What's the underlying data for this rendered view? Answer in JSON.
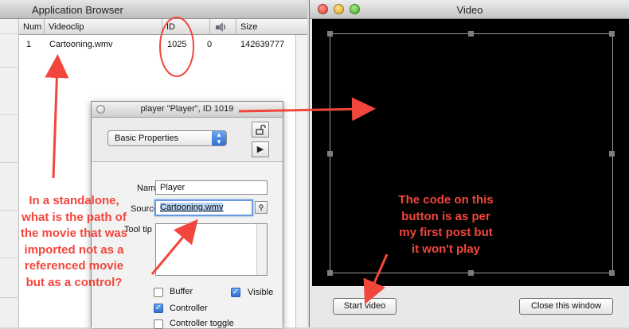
{
  "app_browser": {
    "title": "Application Browser",
    "columns": [
      "Num",
      "Videoclip",
      "ID",
      "",
      "Size"
    ],
    "header_icon": "speaker-icon",
    "rows": [
      {
        "num": "1",
        "videoclip": "Cartooning.wmv",
        "id": "1025",
        "flag": "0",
        "size": "142639777"
      }
    ]
  },
  "inspector": {
    "title": "player \"Player\", ID 1019",
    "dropdown_value": "Basic Properties",
    "lock_icon": "unlock-icon",
    "play_icon": "play-icon",
    "name_label": "Name",
    "name_value": "Player",
    "source_label": "Source",
    "source_value": "Cartooning.wmv",
    "tooltip_label": "Tool tip",
    "tooltip_value": "",
    "buffer_label": "Buffer",
    "visible_label": "Visible",
    "controller_label": "Controller",
    "controller_toggle_label": "Controller toggle",
    "buffer_checked": false,
    "visible_checked": true,
    "controller_checked": true,
    "controller_toggle_checked": false
  },
  "video_window": {
    "title": "Video",
    "start_button": "Start video",
    "close_button": "Close this window"
  },
  "annotations": {
    "left_note": "In a standalone what is the path of the movie that was imported not as a referenced movie but as a control?",
    "left_note_lines": [
      "In a standalone,",
      "what is the path of",
      "the movie that was",
      "imported not as a",
      "referenced movie",
      "but as a control?"
    ],
    "right_note_lines": [
      "The code on this",
      "button is as per",
      "my first post but",
      "it won't play"
    ],
    "accent_color": "#f2463c"
  }
}
